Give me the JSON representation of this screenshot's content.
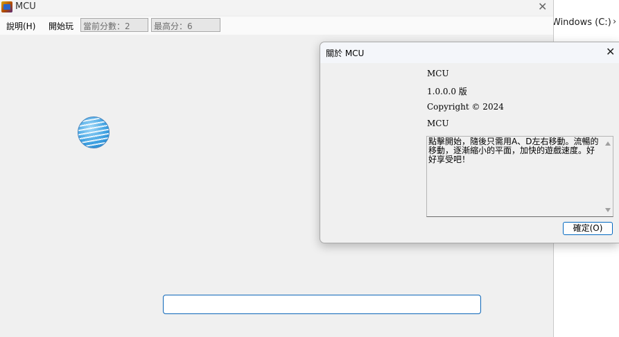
{
  "background_window": {
    "address_text": "Windows (C:)",
    "chevron": "›"
  },
  "main_window": {
    "title": "MCU",
    "icon": "app-icon",
    "close_glyph": "✕",
    "menu": {
      "help": "說明(H)",
      "start": "開始玩"
    },
    "current_score": "當前分數：2",
    "high_score": "最高分：6",
    "ball_color": "#3a9ee0",
    "paddle_border_color": "#0b65b8"
  },
  "about_dialog": {
    "title": "關於 MCU",
    "close_glyph": "✕",
    "product_name": "MCU",
    "version": "1.0.0.0 版",
    "copyright": "Copyright ©  2024",
    "company": "MCU",
    "description": "點擊開始，隨後只需用A、D左右移動。流暢的移動，逐漸縮小的平面，加快的遊戲速度。好好享受吧！",
    "ok_label": "確定(O)",
    "accent_color": "#0067c0"
  }
}
